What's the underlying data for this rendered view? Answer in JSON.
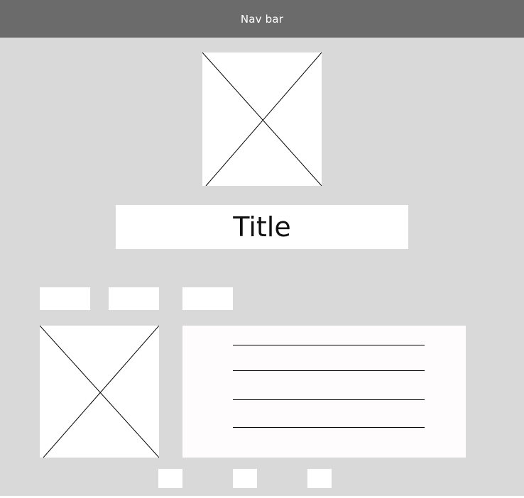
{
  "navbar": {
    "title": "Nav bar"
  },
  "hero": {
    "image_icon": "image-placeholder-icon"
  },
  "title_box": {
    "text": "Title"
  },
  "tabs": [
    {
      "label": ""
    },
    {
      "label": ""
    },
    {
      "label": ""
    }
  ],
  "content": {
    "image_icon": "image-placeholder-icon",
    "text_lines": 4
  },
  "pagination": [
    {
      "label": ""
    },
    {
      "label": ""
    },
    {
      "label": ""
    }
  ],
  "colors": {
    "background": "#d9d9d9",
    "navbar": "#6b6b6b",
    "box": "#ffffff"
  }
}
